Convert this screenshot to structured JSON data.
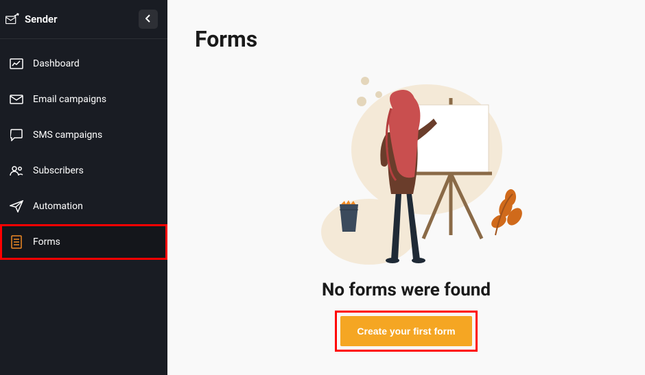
{
  "brand": "Sender",
  "sidebar": {
    "items": [
      {
        "label": "Dashboard"
      },
      {
        "label": "Email campaigns"
      },
      {
        "label": "SMS campaigns"
      },
      {
        "label": "Subscribers"
      },
      {
        "label": "Automation"
      },
      {
        "label": "Forms"
      }
    ]
  },
  "main": {
    "title": "Forms",
    "empty": {
      "heading": "No forms were found",
      "cta_label": "Create your first form"
    }
  }
}
